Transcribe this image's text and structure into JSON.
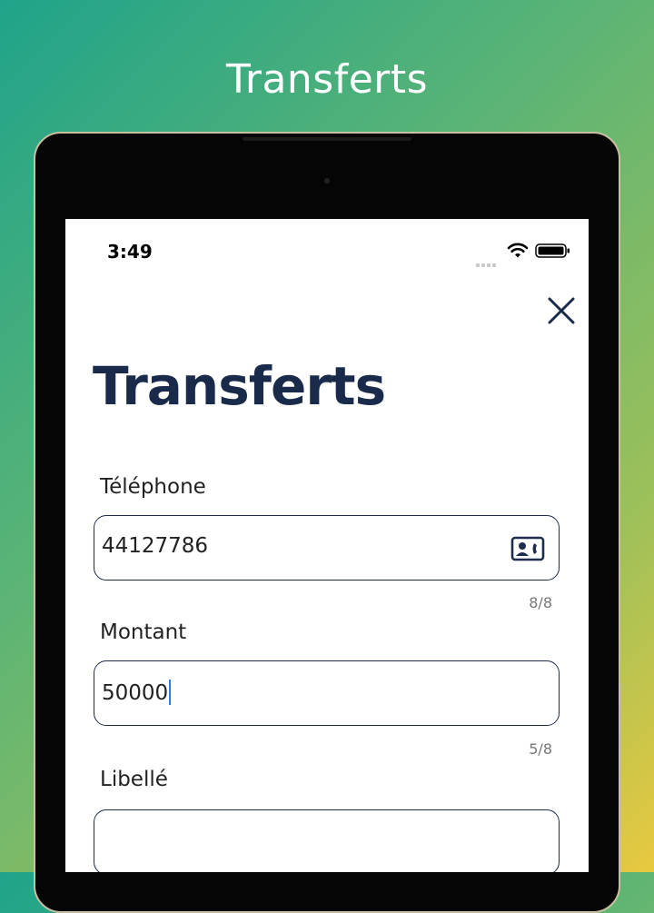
{
  "banner": {
    "title": "Transferts"
  },
  "status_bar": {
    "time": "3:49"
  },
  "page": {
    "title": "Transferts"
  },
  "fields": {
    "phone": {
      "label": "Téléphone",
      "value": "44127786",
      "counter": "8/8",
      "icon": "contact-card-icon"
    },
    "amount": {
      "label": "Montant",
      "value": "50000",
      "counter": "5/8"
    },
    "description": {
      "label": "Libellé",
      "value": ""
    }
  },
  "colors": {
    "title": "#1a2a4a",
    "border": "#1f2d4d",
    "cursor": "#2f7de1",
    "counter": "#777777"
  }
}
